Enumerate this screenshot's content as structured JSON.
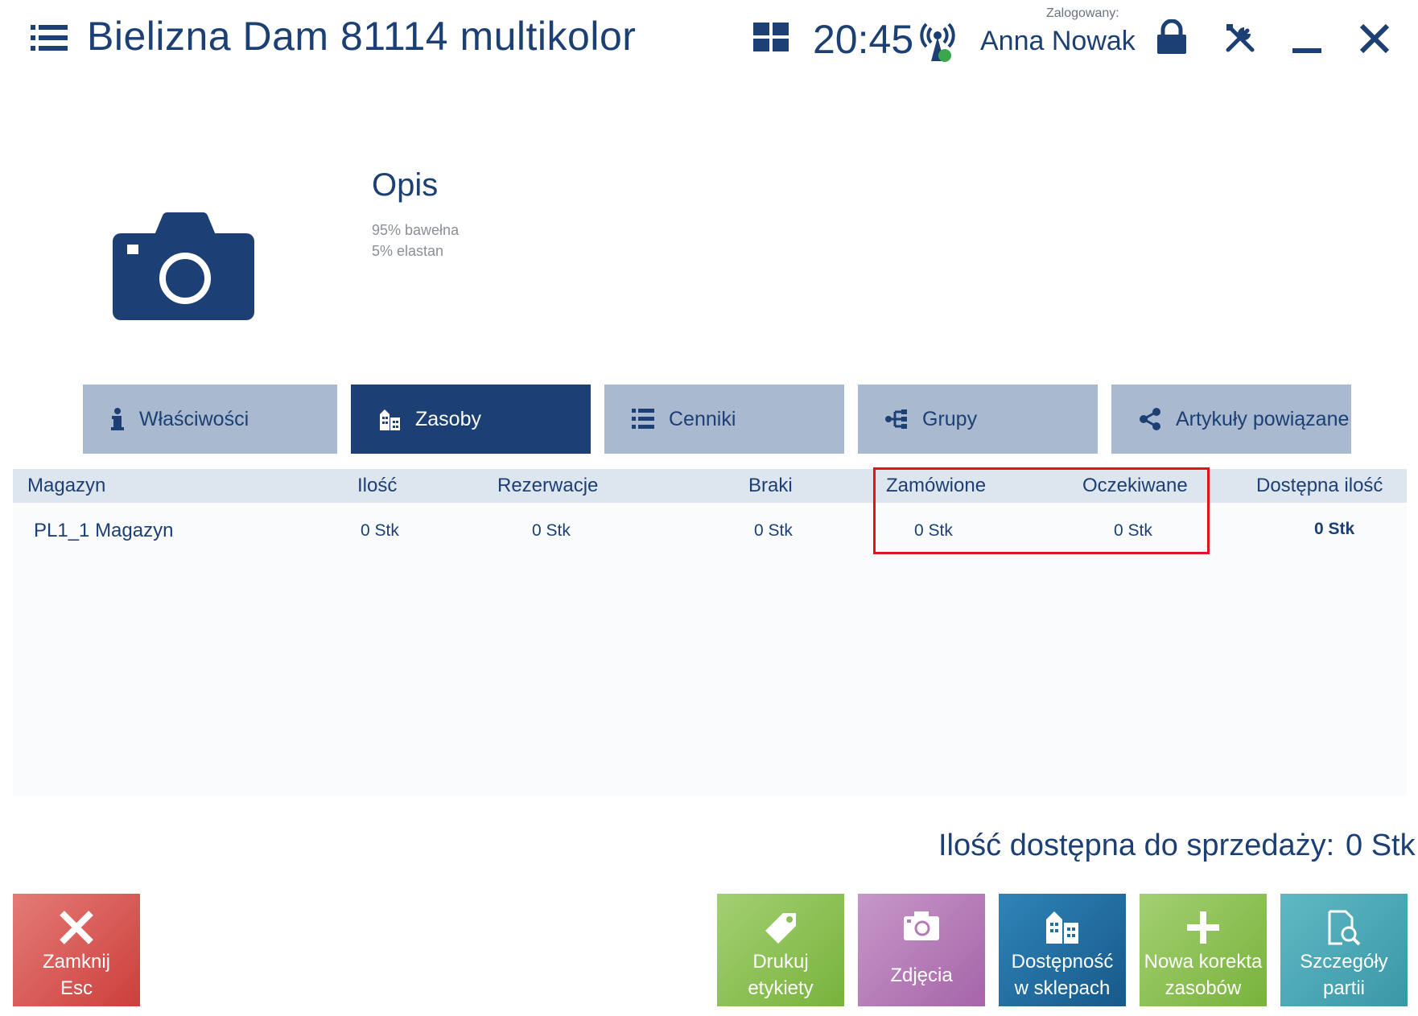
{
  "header": {
    "title": "Bielizna Dam 81114 multikolor",
    "clock": "20:45",
    "logged_label": "Zalogowany:",
    "user_name": "Anna Nowak"
  },
  "product": {
    "description_title": "Opis",
    "description_lines": [
      "95% bawełna",
      "5% elastan"
    ]
  },
  "tabs": [
    {
      "label": "Właściwości",
      "icon": "info-icon",
      "active": false
    },
    {
      "label": "Zasoby",
      "icon": "buildings-icon",
      "active": true
    },
    {
      "label": "Cenniki",
      "icon": "list-icon",
      "active": false
    },
    {
      "label": "Grupy",
      "icon": "tree-icon",
      "active": false
    },
    {
      "label": "Artykuły powiązane",
      "icon": "share-icon",
      "active": false
    }
  ],
  "table": {
    "columns": [
      "Magazyn",
      "Ilość",
      "Rezerwacje",
      "Braki",
      "Zamówione",
      "Oczekiwane",
      "Dostępna ilość"
    ],
    "rows": [
      [
        "PL1_1 Magazyn",
        "0 Stk",
        "0 Stk",
        "0 Stk",
        "0 Stk",
        "0 Stk",
        "0 Stk"
      ]
    ]
  },
  "summary": {
    "label": "Ilość dostępna do sprzedaży:",
    "value": "0 Stk"
  },
  "buttons": {
    "close": {
      "line1": "Zamknij",
      "line2": "Esc",
      "color": "#d9534f"
    },
    "print_labels": {
      "line1": "Drukuj",
      "line2": "etykiety",
      "color": "#8cc152"
    },
    "photos": {
      "line1": "Zdjęcia",
      "color": "#b57bb7"
    },
    "availability": {
      "line1": "Dostępność",
      "line2": "w sklepach",
      "color": "#1f6fa3"
    },
    "new_correction": {
      "line1": "Nowa korekta",
      "line2": "zasobów",
      "color": "#8cc152"
    },
    "batch_details": {
      "line1": "Szczegóły",
      "line2": "partii",
      "color": "#4aa8b5"
    }
  },
  "colors": {
    "primary": "#1c3f74",
    "tab_inactive": "#a9b9cf",
    "highlight": "#e0141e",
    "status_ok": "#3aa84a"
  }
}
